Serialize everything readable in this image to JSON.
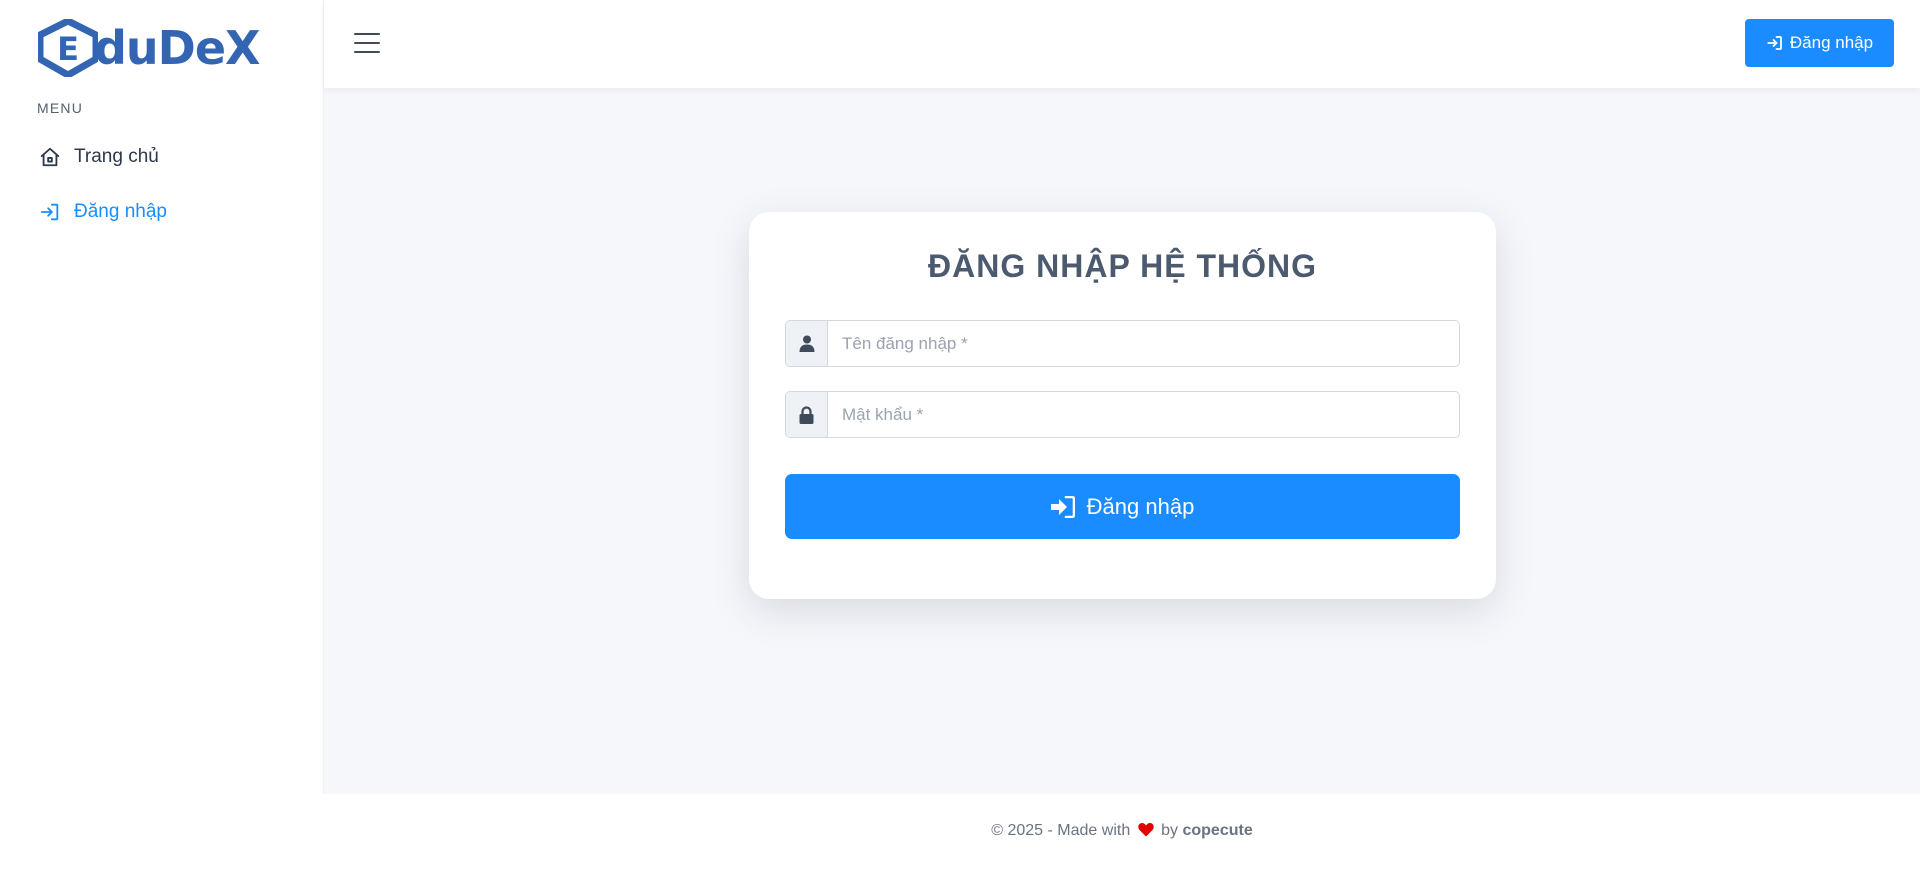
{
  "brand": {
    "name": "duDeX",
    "logo_letter": "E",
    "color": "#3465b3"
  },
  "sidebar": {
    "menu_heading": "MENU",
    "items": [
      {
        "label": "Trang chủ",
        "icon": "home-icon",
        "active": false
      },
      {
        "label": "Đăng nhập",
        "icon": "sign-in-icon",
        "active": true
      }
    ]
  },
  "header": {
    "menu_icon": "hamburger-icon",
    "login_button_label": "Đăng nhập"
  },
  "login_form": {
    "title": "ĐĂNG NHẬP HỆ THỐNG",
    "username_placeholder": "Tên đăng nhập *",
    "username_value": "",
    "username_icon": "user-icon",
    "password_placeholder": "Mật khẩu *",
    "password_value": "",
    "password_icon": "lock-icon",
    "submit_label": "Đăng nhập"
  },
  "footer": {
    "prefix": "© 2025 - Made with",
    "by": "by",
    "author": "copecute",
    "heart_color": "#e00000"
  },
  "colors": {
    "primary": "#1a8cff",
    "main_bg": "#f5f7fb"
  }
}
